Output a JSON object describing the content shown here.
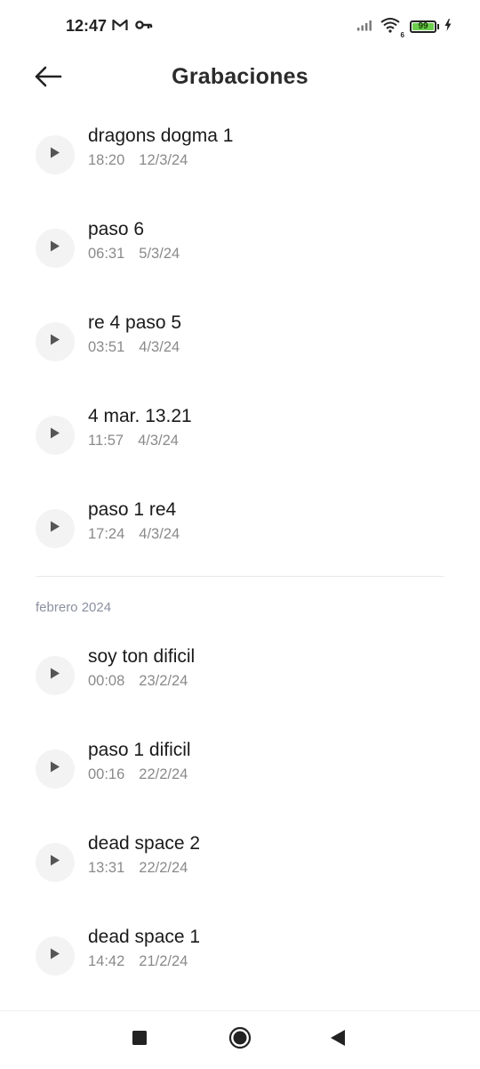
{
  "status_bar": {
    "time": "12:47",
    "left_icons": [
      "gmail-icon",
      "vpn-key-icon"
    ],
    "right_icons": [
      "signal-icon",
      "wifi-icon",
      "battery-icon",
      "charging-icon"
    ],
    "battery_level": 99,
    "battery_text": "99",
    "wifi_badge": "6",
    "battery_color": "#6ccf4d"
  },
  "header": {
    "back_icon": "arrow-left-icon",
    "title": "Grabaciones"
  },
  "sections": [
    {
      "header": "",
      "recordings": [
        {
          "title": "dragons dogma 1",
          "duration": "18:20",
          "date": "12/3/24"
        },
        {
          "title": "paso 6",
          "duration": "06:31",
          "date": "5/3/24"
        },
        {
          "title": "re 4 paso 5",
          "duration": "03:51",
          "date": "4/3/24"
        },
        {
          "title": "4 mar. 13.21",
          "duration": "11:57",
          "date": "4/3/24"
        },
        {
          "title": "paso 1 re4",
          "duration": "17:24",
          "date": "4/3/24"
        }
      ]
    },
    {
      "header": "febrero 2024",
      "recordings": [
        {
          "title": "soy ton dificil",
          "duration": "00:08",
          "date": "23/2/24"
        },
        {
          "title": "paso 1 dificil",
          "duration": "00:16",
          "date": "22/2/24"
        },
        {
          "title": "dead space 2",
          "duration": "13:31",
          "date": "22/2/24"
        },
        {
          "title": "dead space 1",
          "duration": "14:42",
          "date": "21/2/24"
        }
      ]
    }
  ],
  "nav_bar": {
    "icons": [
      "recents-square-icon",
      "home-circle-icon",
      "back-triangle-icon"
    ]
  }
}
